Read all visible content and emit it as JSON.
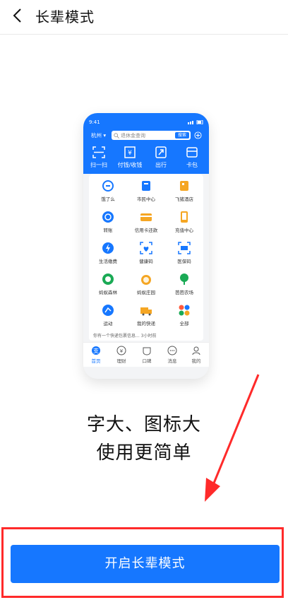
{
  "header": {
    "title": "长辈模式"
  },
  "phone": {
    "status_time": "9:41",
    "city": "杭州",
    "search_placeholder": "退休金查询",
    "search_button": "搜索",
    "quick_actions": [
      {
        "label": "扫一扫",
        "icon": "scan-icon"
      },
      {
        "label": "付钱/收钱",
        "icon": "pay-icon"
      },
      {
        "label": "出行",
        "icon": "travel-icon"
      },
      {
        "label": "卡包",
        "icon": "card-bag-icon"
      }
    ],
    "grid": [
      {
        "label": "饿了么",
        "icon": "eleme-icon"
      },
      {
        "label": "市民中心",
        "icon": "citizen-center-icon"
      },
      {
        "label": "飞猪酒店",
        "icon": "fliggy-hotel-icon"
      },
      {
        "label": "转账",
        "icon": "transfer-icon"
      },
      {
        "label": "信用卡还款",
        "icon": "credit-card-icon"
      },
      {
        "label": "充值中心",
        "icon": "recharge-icon"
      },
      {
        "label": "生活缴费",
        "icon": "utilities-icon"
      },
      {
        "label": "健康码",
        "icon": "health-code-icon"
      },
      {
        "label": "医保码",
        "icon": "medical-code-icon"
      },
      {
        "label": "蚂蚁森林",
        "icon": "ant-forest-icon"
      },
      {
        "label": "蚂蚁庄园",
        "icon": "ant-farm-icon"
      },
      {
        "label": "芭芭农场",
        "icon": "baba-farm-icon"
      },
      {
        "label": "运动",
        "icon": "sport-icon"
      },
      {
        "label": "我的快递",
        "icon": "express-icon"
      },
      {
        "label": "全部",
        "icon": "all-apps-icon"
      }
    ],
    "notice": "你有一个快递包裹信息...  3小时前",
    "tabs": [
      {
        "label": "首页",
        "icon": "home-icon"
      },
      {
        "label": "理财",
        "icon": "wealth-icon"
      },
      {
        "label": "口碑",
        "icon": "koubei-icon"
      },
      {
        "label": "消息",
        "icon": "message-icon"
      },
      {
        "label": "我的",
        "icon": "profile-icon"
      }
    ]
  },
  "tagline": {
    "line1": "字大、图标大",
    "line2": "使用更简单"
  },
  "cta": {
    "label": "开启长辈模式"
  },
  "colors": {
    "brand_blue": "#1677ff",
    "highlight_red": "#ff2a2a"
  }
}
